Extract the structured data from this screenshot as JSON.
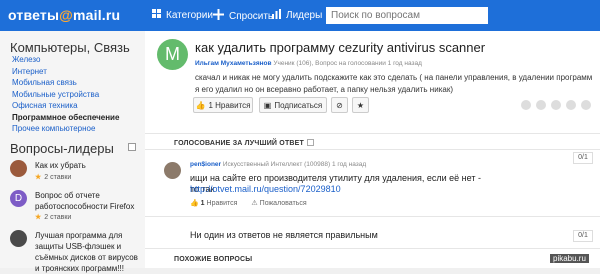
{
  "header": {
    "logo_left": "ответы",
    "logo_at": "@",
    "logo_right": "mail.ru",
    "nav": [
      {
        "icon": "grid-icon",
        "label": "Категории"
      },
      {
        "icon": "plus-icon",
        "label": "Спросить"
      },
      {
        "icon": "bar-chart-icon",
        "label": "Лидеры"
      }
    ],
    "search_placeholder": "Поиск по вопросам"
  },
  "sidebar": {
    "category_title": "Компьютеры, Связь",
    "items": [
      {
        "label": "Железо",
        "active": false
      },
      {
        "label": "Интернет",
        "active": false
      },
      {
        "label": "Мобильная связь",
        "active": false
      },
      {
        "label": "Мобильные устройства",
        "active": false
      },
      {
        "label": "Офисная техника",
        "active": false
      },
      {
        "label": "Программное обеспечение",
        "active": true
      },
      {
        "label": "Прочее компьютерное",
        "active": false
      }
    ],
    "leaders_title": "Вопросы-лидеры",
    "leaders": [
      {
        "question": "Как их убрать",
        "stars": "2 ставки",
        "avatar_color": "#9b5a3c"
      },
      {
        "question": "Вопрос об отчете работоспособности Firefox",
        "stars": "2 ставки",
        "avatar_color": "#7d5cc6",
        "avatar_letter": "D"
      },
      {
        "question": "Лучшая программа для защиты USB-флэшек и съёмных дисков от вирусов и троянских программ!!!",
        "stars": "",
        "avatar_color": "#4a4a4a"
      }
    ]
  },
  "question": {
    "avatar_letter": "M",
    "title": "как удалить программу cezurity antivirus scanner",
    "author": "Ильгам Мухаметьзянов",
    "meta": "Ученик (106), Вопрос на голосовании 1 год назад",
    "body": "скачал и никак не могу удалить подскажите как это сделать ( на панели управления, в удалении программ я его удалил но он всеравно работает, а папку нельзя удалить никак)",
    "like_label": "1 Нравится",
    "subscribe_label": "Подписаться"
  },
  "voting": {
    "title": "ГОЛОСОВАНИЕ ЗА ЛУЧШИЙ ОТВЕТ",
    "counter": "0/1"
  },
  "answer": {
    "author": "pen$ioner",
    "meta": "Искусственный Интеллект (100988) 1 год назад",
    "body": "ищи на сайте его производителя утилиту для удаления, если её нет - то так",
    "link": "http://otvet.mail.ru/question/72029810",
    "likes_count": "1",
    "likes_label": "Нравится",
    "complain_label": "Пожаловаться",
    "counter": "0/1"
  },
  "no_answers_text": "Ни один из ответов не является правильным",
  "similar_title": "ПОХОЖИЕ ВОПРОСЫ",
  "watermark": "pikabu.ru"
}
